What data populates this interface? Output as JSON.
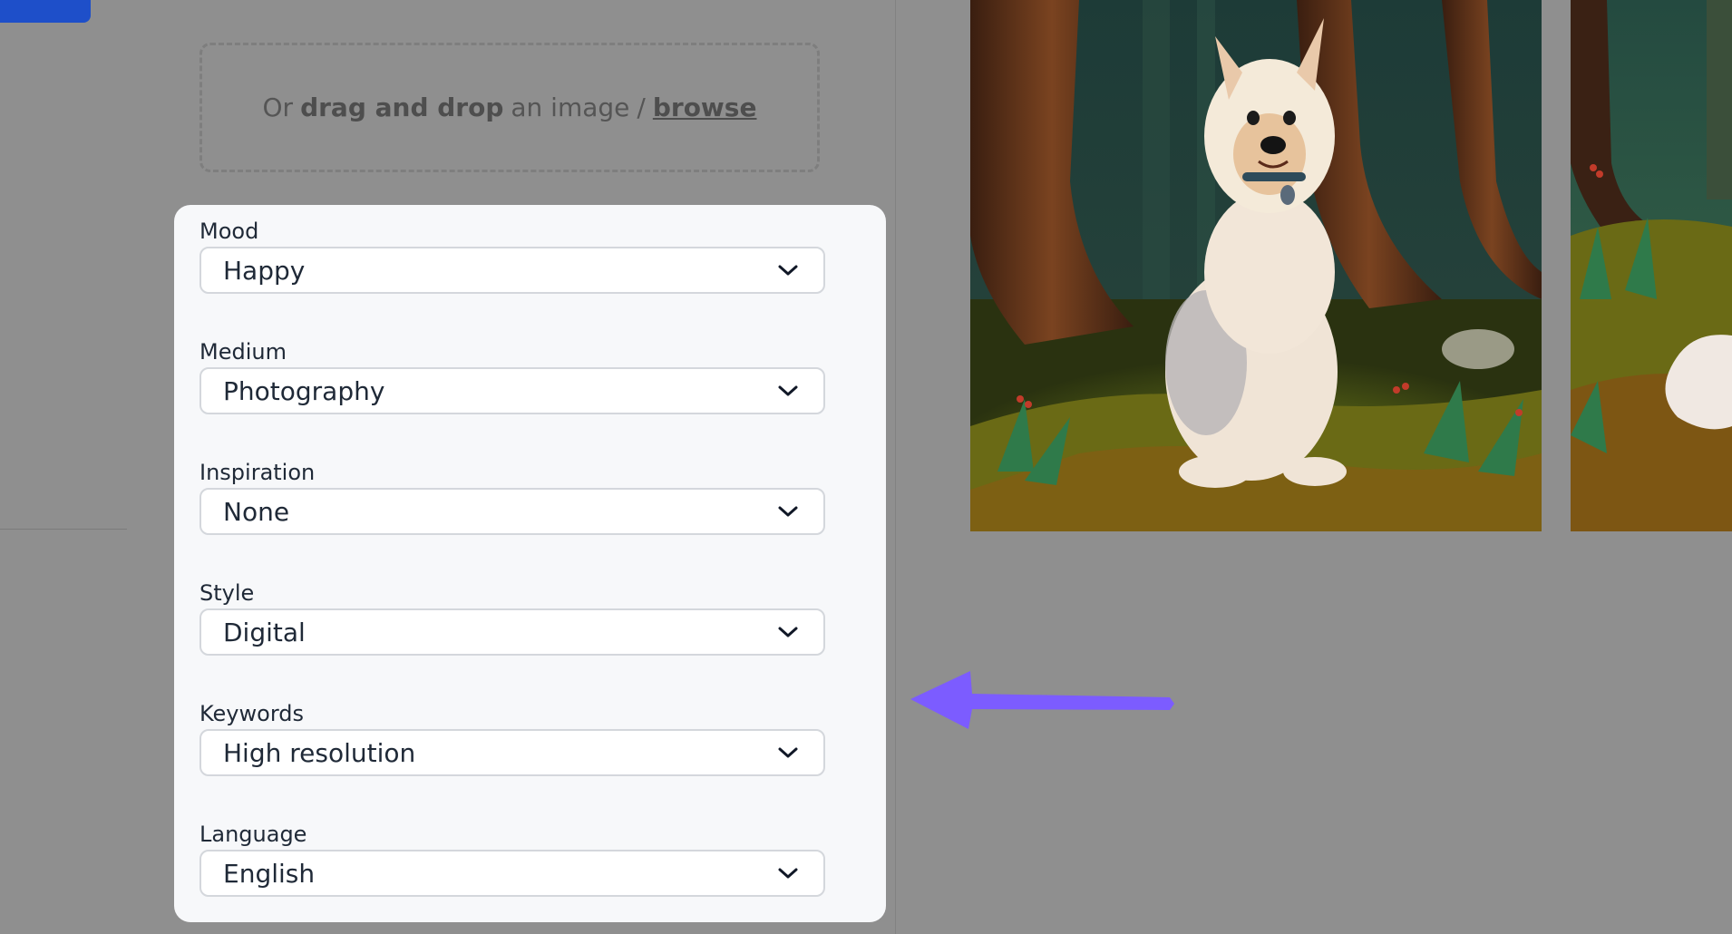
{
  "dropzone": {
    "prefix": "Or",
    "bold": "drag and drop",
    "middle": "an image",
    "separator": "/",
    "browse": "browse"
  },
  "fields": [
    {
      "label": "Mood",
      "value": "Happy",
      "icon": "chevron-down-icon"
    },
    {
      "label": "Medium",
      "value": "Photography",
      "icon": "chevron-down-icon"
    },
    {
      "label": "Inspiration",
      "value": "None",
      "icon": "chevron-down-icon"
    },
    {
      "label": "Style",
      "value": "Digital",
      "icon": "chevron-down-icon"
    },
    {
      "label": "Keywords",
      "value": "High resolution",
      "icon": "chevron-down-icon"
    },
    {
      "label": "Language",
      "value": "English",
      "icon": "chevron-down-icon"
    }
  ],
  "colors": {
    "accent_button": "#1e4fc9",
    "arrow": "#7c5cff",
    "overlay": "#8f8f8f"
  },
  "images": [
    {
      "alt_icon": "dog-painting-image"
    },
    {
      "alt_icon": "forest-painting-image"
    }
  ]
}
